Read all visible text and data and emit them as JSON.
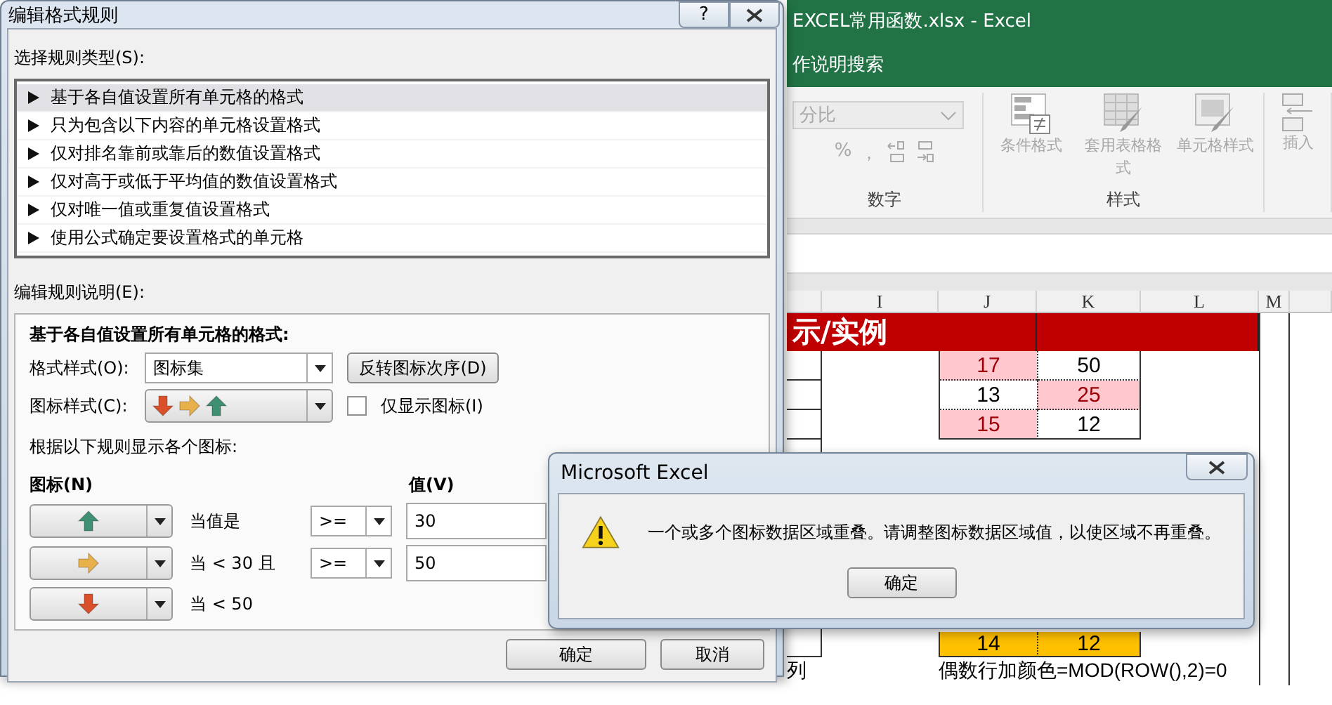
{
  "excel": {
    "title": "EXCEL常用函数.xlsx - Excel",
    "tell_me": "作说明搜索",
    "number_format": "分比",
    "percent": "%",
    "comma": "，",
    "number_group": "数字",
    "commands": [
      {
        "kind": "conditional",
        "label": "条件格式"
      },
      {
        "kind": "table",
        "label": "套用表格格式"
      },
      {
        "kind": "cellstyle",
        "label": "单元格样式"
      }
    ],
    "styles_group": "样式",
    "insert": "插入",
    "columns": [
      "I",
      "J",
      "K",
      "L",
      "M"
    ],
    "banner": "示/实例",
    "rows": [
      {
        "j": "17",
        "k": "50",
        "j_highlight": true,
        "k_highlight": false
      },
      {
        "j": "13",
        "k": "25",
        "j_highlight": false,
        "k_highlight": true
      },
      {
        "j": "15",
        "k": "12",
        "j_highlight": true,
        "k_highlight": false
      }
    ],
    "even_row": {
      "j": "14",
      "k": "12"
    },
    "even_note": "偶数行加颜色=MOD(ROW(),2)=0",
    "left_note": "列"
  },
  "dialog": {
    "title": "编辑格式规则",
    "help": "?",
    "rule_type_label": "选择规则类型(S):",
    "rule_types": [
      {
        "label": "基于各自值设置所有单元格的格式",
        "selected": true
      },
      {
        "label": "只为包含以下内容的单元格设置格式",
        "selected": false
      },
      {
        "label": "仅对排名靠前或靠后的数值设置格式",
        "selected": false
      },
      {
        "label": "仅对高于或低于平均值的数值设置格式",
        "selected": false
      },
      {
        "label": "仅对唯一值或重复值设置格式",
        "selected": false
      },
      {
        "label": "使用公式确定要设置格式的单元格",
        "selected": false
      }
    ],
    "description_label": "编辑规则说明(E):",
    "heading": "基于各自值设置所有单元格的格式:",
    "format_style": {
      "label": "格式样式(O):",
      "value": "图标集"
    },
    "reverse_button": "反转图标次序(D)",
    "icon_style_label": "图标样式(C):",
    "show_icon_only": {
      "label": "仅显示图标(I)",
      "checked": false
    },
    "rules_label": "根据以下规则显示各个图标:",
    "icon_header": "图标(N)",
    "value_header": "值(V)",
    "rules": [
      {
        "kind": "up",
        "color": "#3f8f72",
        "condition": "当值是",
        "operator": ">=",
        "value": "30"
      },
      {
        "kind": "right",
        "color": "#e8b04a",
        "condition": "当 < 30 且",
        "operator": ">=",
        "value": "50"
      },
      {
        "kind": "down",
        "color": "#d9502b",
        "condition": "当 < 50"
      }
    ],
    "buttons": [
      "确定",
      "取消"
    ]
  },
  "message_box": {
    "title": "Microsoft Excel",
    "message": "一个或多个图标数据区域重叠。请调整图标数据区域值，以使区域不再重叠。",
    "button": "确定"
  }
}
